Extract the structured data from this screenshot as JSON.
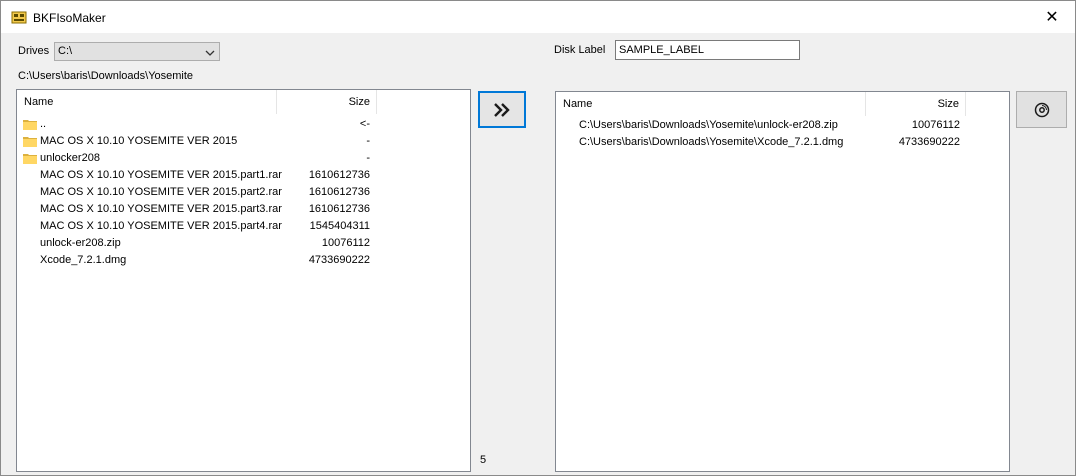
{
  "window": {
    "title": "BKFIsoMaker",
    "close_symbol": "✕"
  },
  "drives": {
    "label": "Drives",
    "selected": "C:\\",
    "arrow": "▾"
  },
  "current_path": "C:\\Users\\baris\\Downloads\\Yosemite",
  "left_list": {
    "columns": {
      "name": "Name",
      "size": "Size"
    },
    "rows": [
      {
        "name": "..",
        "size": "<-",
        "folder": true
      },
      {
        "name": "MAC OS X 10.10 YOSEMITE VER 2015",
        "size": "-",
        "folder": true
      },
      {
        "name": "unlocker208",
        "size": "-",
        "folder": true
      },
      {
        "name": "MAC OS X 10.10 YOSEMITE VER 2015.part1.rar",
        "size": "1610612736",
        "folder": false
      },
      {
        "name": "MAC OS X 10.10 YOSEMITE VER 2015.part2.rar",
        "size": "1610612736",
        "folder": false
      },
      {
        "name": "MAC OS X 10.10 YOSEMITE VER 2015.part3.rar",
        "size": "1610612736",
        "folder": false
      },
      {
        "name": "MAC OS X 10.10 YOSEMITE VER 2015.part4.rar",
        "size": "1545404311",
        "folder": false
      },
      {
        "name": "unlock-er208.zip",
        "size": "10076112",
        "folder": false
      },
      {
        "name": "Xcode_7.2.1.dmg",
        "size": "4733690222",
        "folder": false
      }
    ]
  },
  "add_button": {
    "symbol": "»",
    "icon": "double-chevron-right-icon"
  },
  "item_count": "5",
  "disk_label": {
    "label": "Disk Label",
    "value": "SAMPLE_LABEL"
  },
  "right_list": {
    "columns": {
      "name": "Name",
      "size": "Size"
    },
    "rows": [
      {
        "name": "C:\\Users\\baris\\Downloads\\Yosemite\\unlock-er208.zip",
        "size": "10076112"
      },
      {
        "name": "C:\\Users\\baris\\Downloads\\Yosemite\\Xcode_7.2.1.dmg",
        "size": "4733690222"
      }
    ]
  },
  "burn_button": {
    "icon": "disc-icon"
  },
  "colors": {
    "accent": "#0078d7",
    "folder": "#ffd764",
    "window_bg": "#f0f0f0"
  }
}
